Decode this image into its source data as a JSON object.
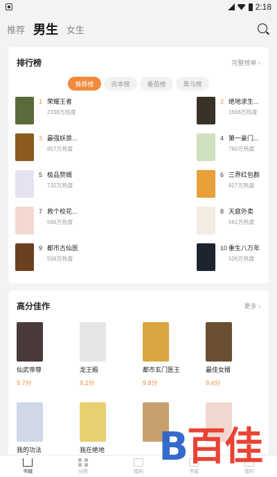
{
  "status_bar": {
    "time": "2:18"
  },
  "top_nav": {
    "tabs": [
      {
        "label": "推荐",
        "active": false
      },
      {
        "label": "男生",
        "active": true
      },
      {
        "label": "女生",
        "active": false
      }
    ],
    "search_icon": "search-icon"
  },
  "ranking": {
    "title": "排行榜",
    "more": "完整榜单 ›",
    "subtabs": [
      {
        "label": "推荐榜",
        "active": true
      },
      {
        "label": "完本榜",
        "active": false
      },
      {
        "label": "番茄榜",
        "active": false
      },
      {
        "label": "黑马榜",
        "active": false
      }
    ],
    "items": [
      {
        "rank": "1",
        "name": "荣耀王者",
        "heat": "2338万热度",
        "cover_color": "#5a6b3a",
        "num_color": "#f08a3c"
      },
      {
        "rank": "2",
        "name": "绝地求生...",
        "heat": "1566万热度",
        "cover_color": "#3a3226",
        "num_color": "#f08a3c"
      },
      {
        "rank": "3",
        "name": "最强妖兽...",
        "heat": "857万热度",
        "cover_color": "#8a5a1e",
        "num_color": "#f08a3c"
      },
      {
        "rank": "4",
        "name": "第一豪门...",
        "heat": "760万热度",
        "cover_color": "#cfe0c0",
        "num_color": "#333333"
      },
      {
        "rank": "5",
        "name": "极品赘婿",
        "heat": "732万热度",
        "cover_color": "#e7e2f0",
        "num_color": "#333333"
      },
      {
        "rank": "6",
        "name": "三界红包群",
        "heat": "627万热度",
        "cover_color": "#e8a03a",
        "num_color": "#333333"
      },
      {
        "rank": "7",
        "name": "救个校花...",
        "heat": "566万热度",
        "cover_color": "#f3d8d0",
        "num_color": "#333333"
      },
      {
        "rank": "8",
        "name": "天庭外卖",
        "heat": "561万热度",
        "cover_color": "#f4ece0",
        "num_color": "#333333"
      },
      {
        "rank": "9",
        "name": "都市古仙医",
        "heat": "558万热度",
        "cover_color": "#6a4020",
        "num_color": "#333333"
      },
      {
        "rank": "10",
        "name": "重生八万年",
        "heat": "526万热度",
        "cover_color": "#1c2430",
        "num_color": "#333333"
      }
    ]
  },
  "top_rated": {
    "title": "高分佳作",
    "more": "更多 ›",
    "items": [
      {
        "name": "仙武帝尊",
        "score": "9.7分",
        "cover_color": "#4a3a3a"
      },
      {
        "name": "龙王殿",
        "score": "9.2分",
        "cover_color": "#e6e6e6"
      },
      {
        "name": "都市玄门医王",
        "score": "9.8分",
        "cover_color": "#d9a640"
      },
      {
        "name": "最佳女婿",
        "score": "9.4分",
        "cover_color": "#6a5030"
      },
      {
        "name": "我的功法",
        "score": "",
        "cover_color": "#d0d8e8"
      },
      {
        "name": "我在绝地",
        "score": "",
        "cover_color": "#e8d070"
      },
      {
        "name": "",
        "score": "",
        "cover_color": "#c8a070"
      },
      {
        "name": "",
        "score": "",
        "cover_color": "#f0d8d0"
      }
    ]
  },
  "bottom_bar": {
    "items": [
      {
        "label": "书城",
        "icon": "home-icon",
        "active": true
      },
      {
        "label": "分类",
        "icon": "category-icon",
        "active": false
      },
      {
        "label": "福利",
        "icon": "gift-icon",
        "active": false
      },
      {
        "label": "书架",
        "icon": "bookshelf-icon",
        "active": false
      },
      {
        "label": "我的",
        "icon": "profile-icon",
        "active": false
      }
    ]
  },
  "watermark": {
    "text_a": "B",
    "text_b": "百佳"
  }
}
